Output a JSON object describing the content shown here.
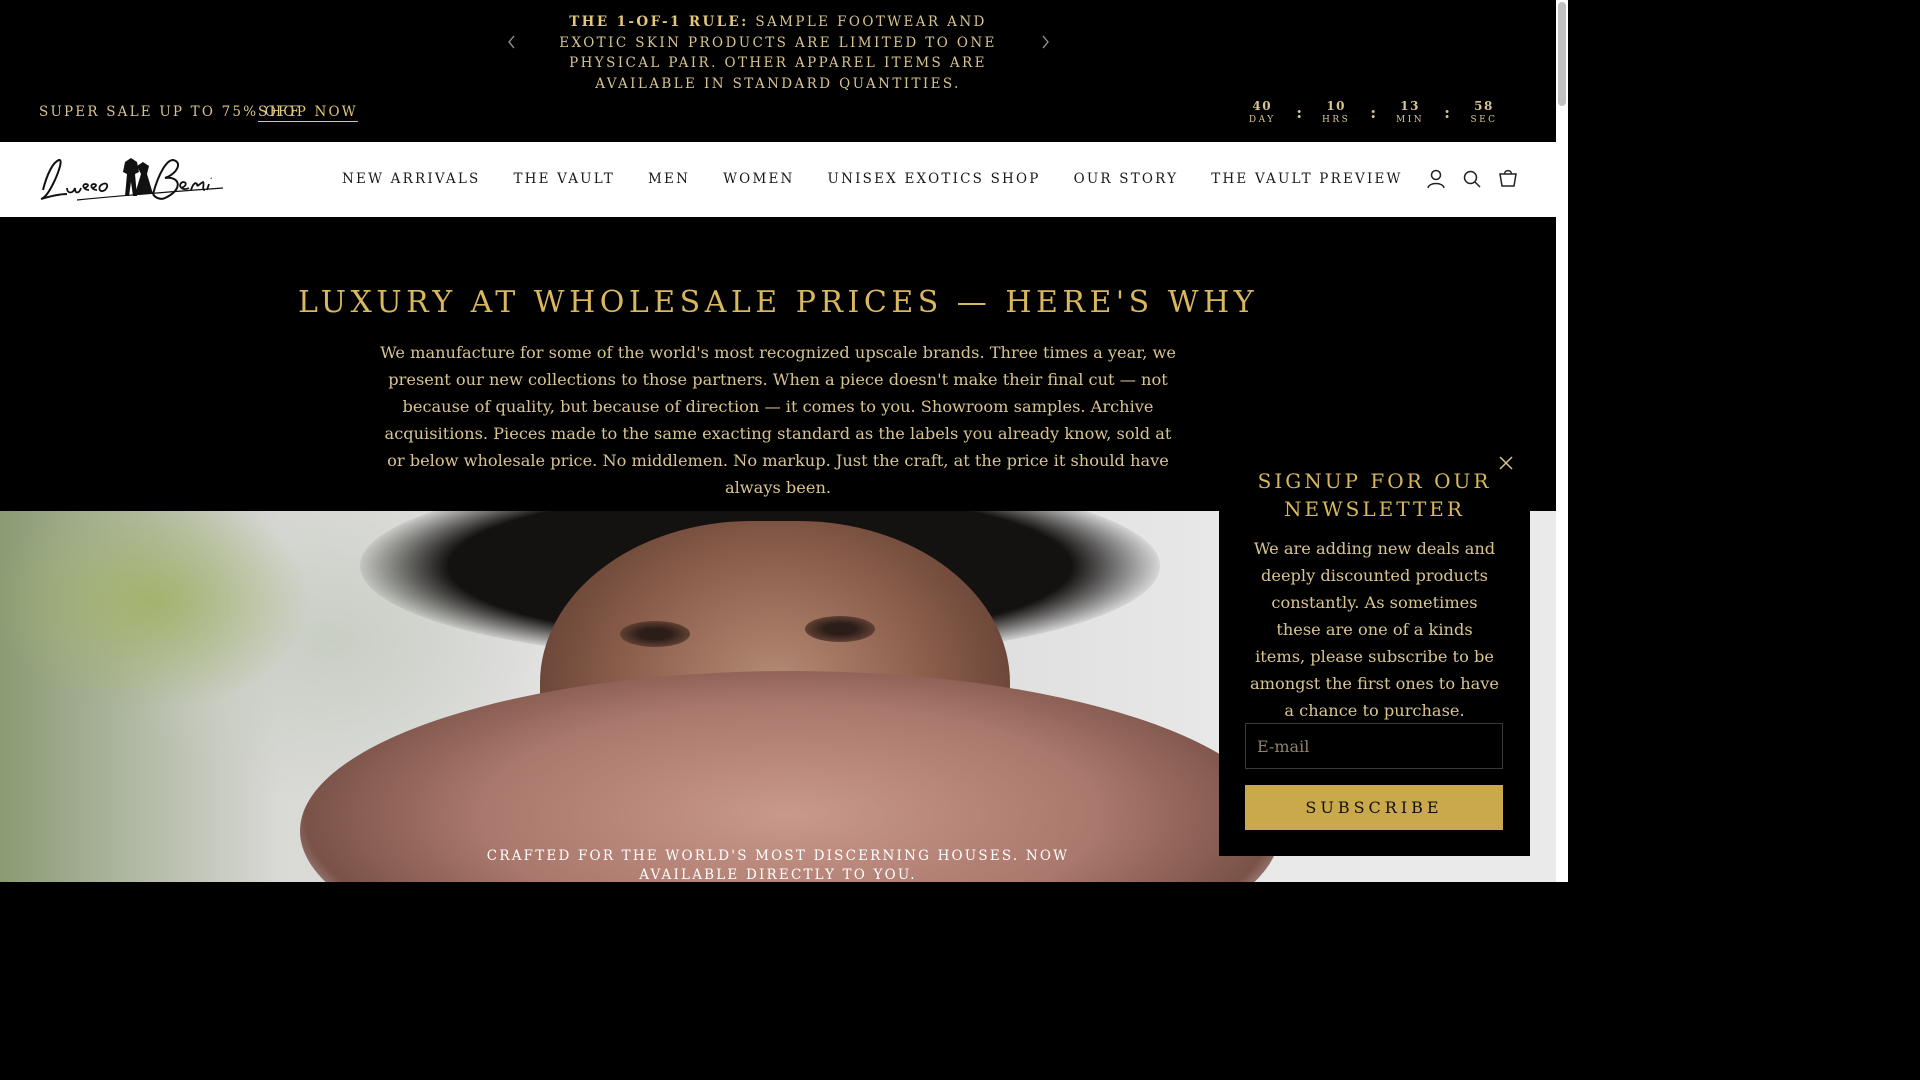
{
  "announcement": {
    "rule_label": "THE 1-OF-1 RULE:",
    "rule_text": " SAMPLE FOOTWEAR AND EXOTIC SKIN PRODUCTS ARE LIMITED TO ONE PHYSICAL PAIR. OTHER APPAREL ITEMS ARE AVAILABLE IN STANDARD QUANTITIES.",
    "prev_icon": "chevron-left-icon",
    "next_icon": "chevron-right-icon"
  },
  "promo": {
    "sale_text": "SUPER SALE UP TO 75% OFF",
    "shop_now": "SHOP NOW"
  },
  "countdown": {
    "day": {
      "value": "40",
      "label": "DAY"
    },
    "hrs": {
      "value": "10",
      "label": "HRS"
    },
    "min": {
      "value": "13",
      "label": "MIN"
    },
    "sec": {
      "value": "58",
      "label": "SEC"
    },
    "separator": ":"
  },
  "header": {
    "logo_text": "LussoBeni",
    "nav": [
      "NEW ARRIVALS",
      "THE VAULT",
      "MEN",
      "WOMEN",
      "UNISEX EXOTICS SHOP",
      "OUR STORY",
      "THE VAULT PREVIEW"
    ],
    "icons": [
      "account-icon",
      "search-icon",
      "cart-icon"
    ]
  },
  "why": {
    "title": "LUXURY AT WHOLESALE PRICES — HERE'S WHY",
    "body": "We manufacture for some of the world's most recognized upscale brands. Three times a year, we present our new collections to those partners. When a piece doesn't make their final cut — not because of quality, but because of direction — it comes to you. Showroom samples. Archive acquisitions. Pieces made to the same exacting standard as the labels you already know, sold at or below wholesale price. No middlemen. No markup. Just the craft, at the price it should have always been."
  },
  "hero": {
    "caption": "CRAFTED FOR THE WORLD'S MOST DISCERNING HOUSES. NOW AVAILABLE DIRECTLY TO YOU."
  },
  "newsletter": {
    "title": "SIGNUP FOR OUR NEWSLETTER",
    "body": "We are adding new deals and deeply discounted products constantly. As sometimes these are one of a kinds items, please subscribe to be amongst the first ones to have a chance to purchase.",
    "email_placeholder": "E-mail",
    "email_value": "",
    "subscribe_label": "SUBSCRIBE",
    "close_icon": "close-icon"
  },
  "colors": {
    "gold": "#d8b75e",
    "gold_text": "#d8c48f",
    "button_gold": "#c9a94c",
    "background": "#000000",
    "header_bg": "#ffffff"
  }
}
